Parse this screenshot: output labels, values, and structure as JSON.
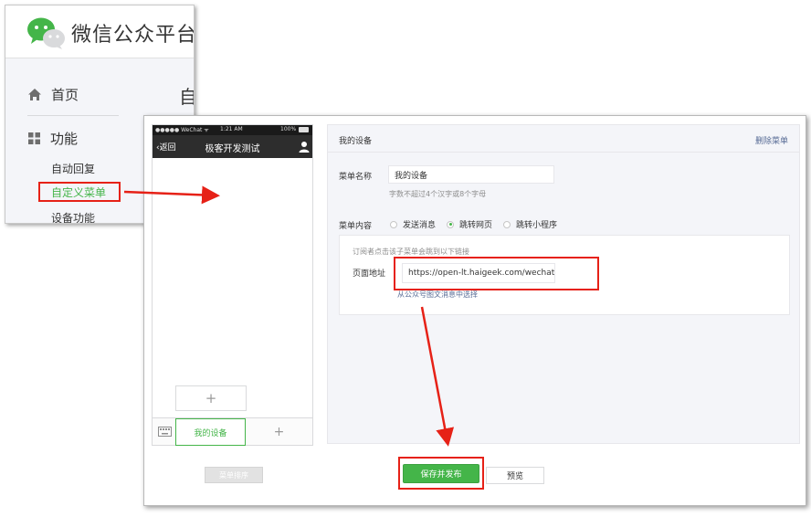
{
  "app": {
    "brand": "微信公众平台"
  },
  "sidebar": {
    "home": "首页",
    "function": "功能",
    "auto_reply": "自动回复",
    "custom_menu": "自定义菜单",
    "device": "设备功能",
    "page_char": "自"
  },
  "phone": {
    "carrier": "●●●●● WeChat ᯤ",
    "time": "1:21 AM",
    "battery": "100%",
    "back": "返回",
    "title": "极客开发测试",
    "sub_add": "+",
    "menu_item": "我的设备",
    "menu_add": "+"
  },
  "editor": {
    "title": "我的设备",
    "delete": "删除菜单",
    "name_label": "菜单名称",
    "name_value": "我的设备",
    "name_hint": "字数不超过4个汉字或8个字母",
    "content_label": "菜单内容",
    "options": [
      "发送消息",
      "跳转网页",
      "跳转小程序"
    ],
    "selected_option": "跳转网页",
    "content_desc": "订阅者点击该子菜单会跳到以下链接",
    "url_label": "页面地址",
    "url_value": "https://open-lt.haigeek.com/wechat",
    "url_from": "从公众号图文消息中选择"
  },
  "toolbar": {
    "sort": "菜单排序",
    "save": "保存并发布",
    "preview": "预览"
  },
  "colors": {
    "accent": "#44b549",
    "highlight": "#e62117",
    "link": "#576b95",
    "phone_bar": "#2d2d2d"
  }
}
